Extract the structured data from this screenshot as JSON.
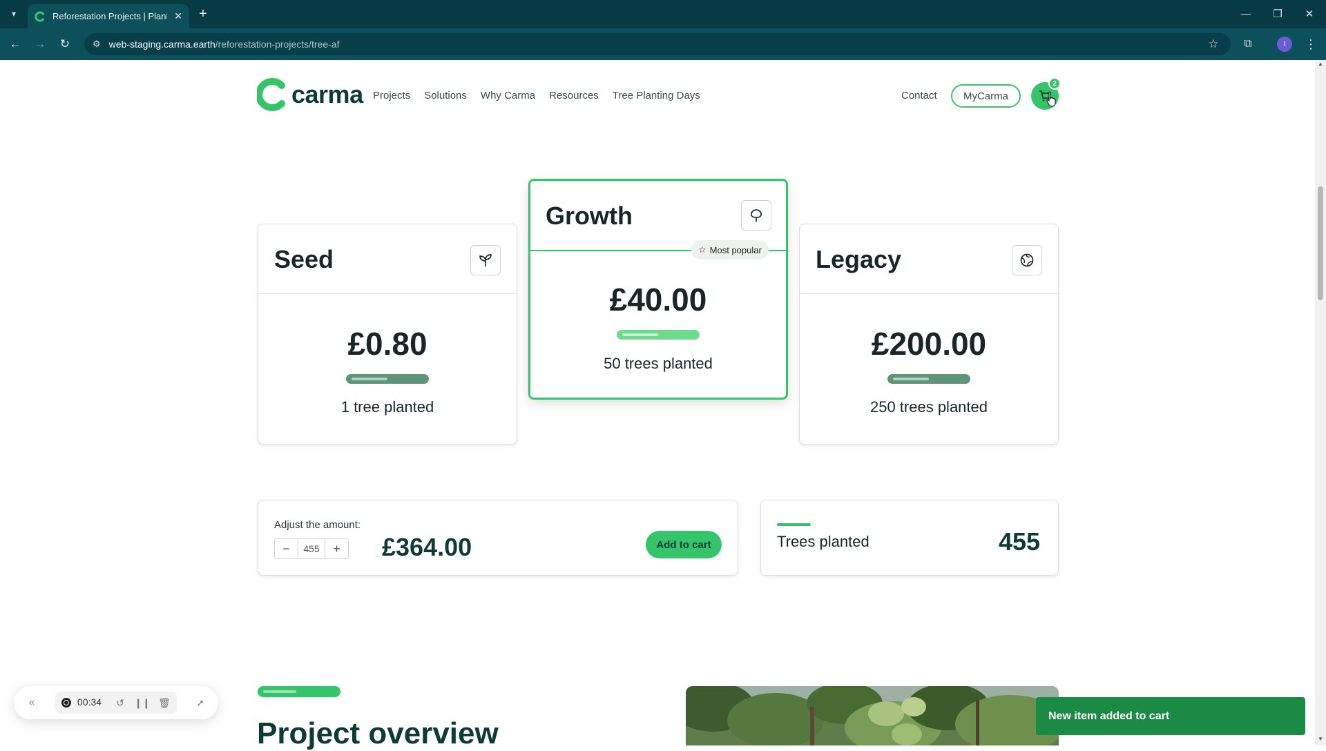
{
  "browser": {
    "tab_title": "Reforestation Projects | Plant Tr",
    "url_host": "web-staging.carma.earth",
    "url_path": "/reforestation-projects/tree-af",
    "profile_initial": "I"
  },
  "header": {
    "logo_text": "carma",
    "nav": [
      "Projects",
      "Solutions",
      "Why Carma",
      "Resources",
      "Tree Planting Days"
    ],
    "contact_label": "Contact",
    "mycarma_label": "MyCarma",
    "cart_count": "2"
  },
  "plans": {
    "seed": {
      "name": "Seed",
      "price": "£0.80",
      "trees": "1 tree planted",
      "icon": "sprout-icon"
    },
    "growth": {
      "name": "Growth",
      "price": "£40.00",
      "trees": "50 trees planted",
      "badge": "Most popular",
      "icon": "tree-icon"
    },
    "legacy": {
      "name": "Legacy",
      "price": "£200.00",
      "trees": "250 trees planted",
      "icon": "globe-icon"
    }
  },
  "amount": {
    "label": "Adjust the amount:",
    "minus": "−",
    "plus": "+",
    "quantity": "455",
    "total": "£364.00",
    "add_to_cart_label": "Add to cart"
  },
  "trees_summary": {
    "label": "Trees planted",
    "value": "455"
  },
  "overview": {
    "title": "Project overview"
  },
  "toast": {
    "message": "New item added to cart"
  },
  "recorder": {
    "time": "00:34"
  },
  "colors": {
    "brand_green": "#35c46a",
    "brand_dark": "#0e3b34",
    "toast_green": "#1a8a45",
    "chrome_teal": "#0e4f5c"
  }
}
